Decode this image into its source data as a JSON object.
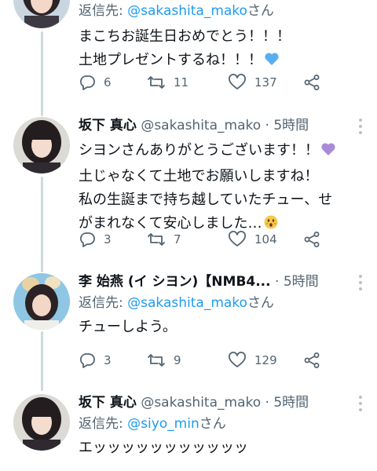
{
  "tweets": [
    {
      "reply_label": "返信先:",
      "reply_to": "@sakashita_mako",
      "reply_suffix": "さん",
      "lines": [
        "まこちお誕生日おめでとう！！！",
        "土地プレゼントするね！！！"
      ],
      "emoji": "blue-heart",
      "stats": {
        "replies": "6",
        "retweets": "11",
        "likes": "137"
      }
    },
    {
      "name": "坂下 真心",
      "handle": "@sakashita_mako",
      "time": "· 5時間",
      "lines": [
        "シヨンさんありがとうございます！！",
        "土じゃなくて土地でお願いしますね！",
        "私の生誕まで持ち越していたチュー、せ",
        "がまれなくて安心しました…"
      ],
      "emoji1": "purple-heart",
      "emoji2": "astonished-face",
      "stats": {
        "replies": "3",
        "retweets": "7",
        "likes": "104"
      }
    },
    {
      "name": "李 始燕 (イ シヨン)【NMB4...",
      "time": "· 5時間",
      "reply_label": "返信先:",
      "reply_to": "@sakashita_mako",
      "reply_suffix": "さん",
      "lines": [
        "チューしよう。"
      ],
      "stats": {
        "replies": "3",
        "retweets": "9",
        "likes": "129"
      }
    },
    {
      "name": "坂下 真心",
      "handle": "@sakashita_mako",
      "time": "· 5時間",
      "reply_label": "返信先:",
      "reply_to": "@siyo_min",
      "reply_suffix": "さん",
      "lines": [
        "エッッッッッッッッッッッ"
      ]
    }
  ],
  "colors": {
    "accent": "#1d9bf0",
    "muted": "#536471",
    "thread": "#cfd9de"
  }
}
